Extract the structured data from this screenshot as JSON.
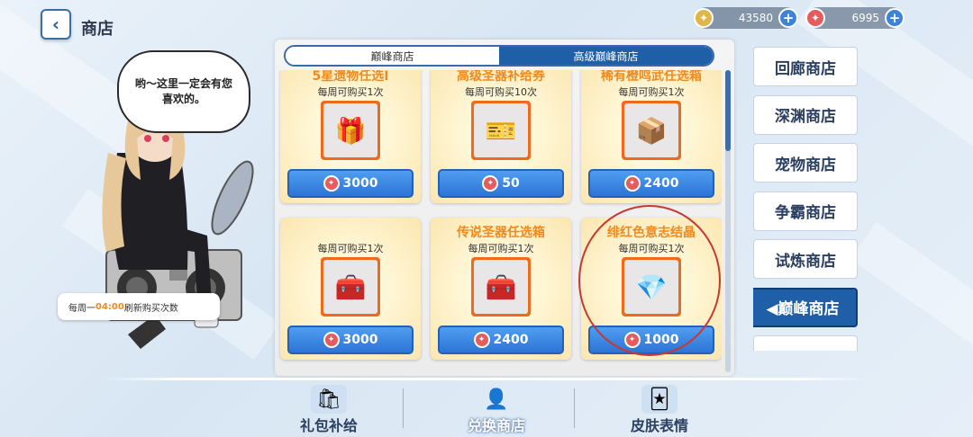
{
  "header": {
    "title": "商店",
    "back_glyph": "‹"
  },
  "currencies": [
    {
      "value": "43580",
      "color": "#e0b64a"
    },
    {
      "value": "6995",
      "color": "#e65b5b"
    }
  ],
  "character": {
    "speech": "哟～这里一定会有您喜欢的。",
    "refresh_prefix": "每周一",
    "refresh_time": "04:00",
    "refresh_suffix": "刷新购买次数"
  },
  "tabs": [
    {
      "label": "巅峰商店",
      "active": false
    },
    {
      "label": "高级巅峰商店",
      "active": true
    }
  ],
  "items": [
    {
      "name": "5星遗物任选Ⅰ",
      "limit": "每周可购买1次",
      "price": "3000",
      "icon": "relic-box-icon",
      "glyph": "🎁"
    },
    {
      "name": "高级圣器补给券",
      "limit": "每周可购买10次",
      "price": "50",
      "icon": "ticket-icon",
      "glyph": "🎫"
    },
    {
      "name": "稀有橙鸣武任选箱",
      "limit": "每周可购买1次",
      "price": "2400",
      "icon": "weapon-box-icon",
      "glyph": "📦"
    },
    {
      "name": "",
      "limit": "每周可购买1次",
      "price": "3000",
      "icon": "blue-chest-icon",
      "glyph": "🧰"
    },
    {
      "name": "传说圣器任选箱",
      "limit": "每周可购买1次",
      "price": "2400",
      "icon": "blue-chest-icon",
      "glyph": "🧰"
    },
    {
      "name": "绯红色意志结晶",
      "limit": "每周可购买1次",
      "price": "1000",
      "icon": "crystal-icon",
      "glyph": "💎"
    }
  ],
  "nav": [
    {
      "label": "回廊商店",
      "active": false
    },
    {
      "label": "深渊商店",
      "active": false
    },
    {
      "label": "宠物商店",
      "active": false
    },
    {
      "label": "争霸商店",
      "active": false
    },
    {
      "label": "试炼商店",
      "active": false
    },
    {
      "label": "◀巅峰商店",
      "active": true
    },
    {
      "label": "",
      "active": false
    }
  ],
  "bottom": [
    {
      "label": "礼包补给",
      "icon": "gift-supply-icon",
      "glyph": "🛍"
    },
    {
      "label": "兑换商店",
      "icon": "exchange-shop-icon",
      "glyph": "👤"
    },
    {
      "label": "皮肤表情",
      "icon": "skin-emote-icon",
      "glyph": "🃏"
    }
  ]
}
